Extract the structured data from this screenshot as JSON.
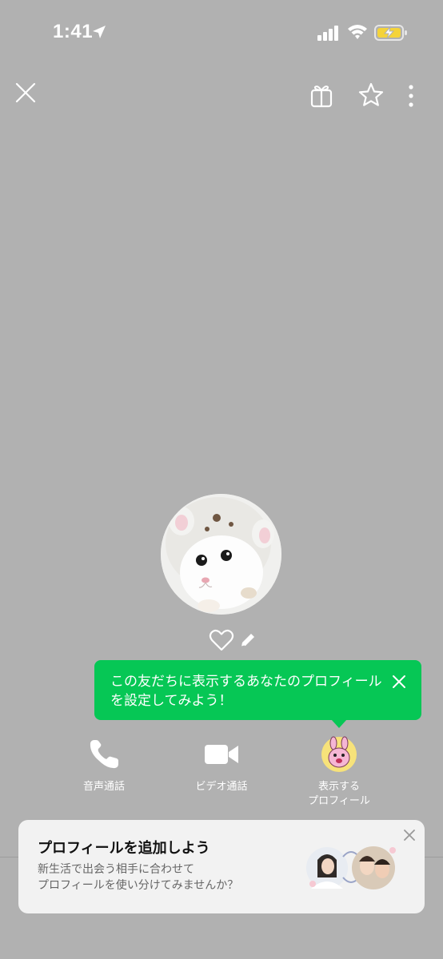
{
  "status_bar": {
    "time": "1:41"
  },
  "colors": {
    "background": "#b1b1b1",
    "line_green": "#06c755",
    "card": "#f2f2f2"
  },
  "header": {
    "icons": [
      "close-icon",
      "gift-icon",
      "star-icon",
      "more-icon"
    ]
  },
  "tooltip": {
    "text": "この友だちに表示するあなたのプロフィール\nを設定してみよう！"
  },
  "actions": {
    "voice_call": "音声通話",
    "video_call": "ビデオ通話",
    "display_profile": "表示する\nプロフィール"
  },
  "promo_card": {
    "title": "プロフィールを追加しよう",
    "description": "新生活で出会う相手に合わせて\nプロフィールを使い分けてみませんか？"
  }
}
